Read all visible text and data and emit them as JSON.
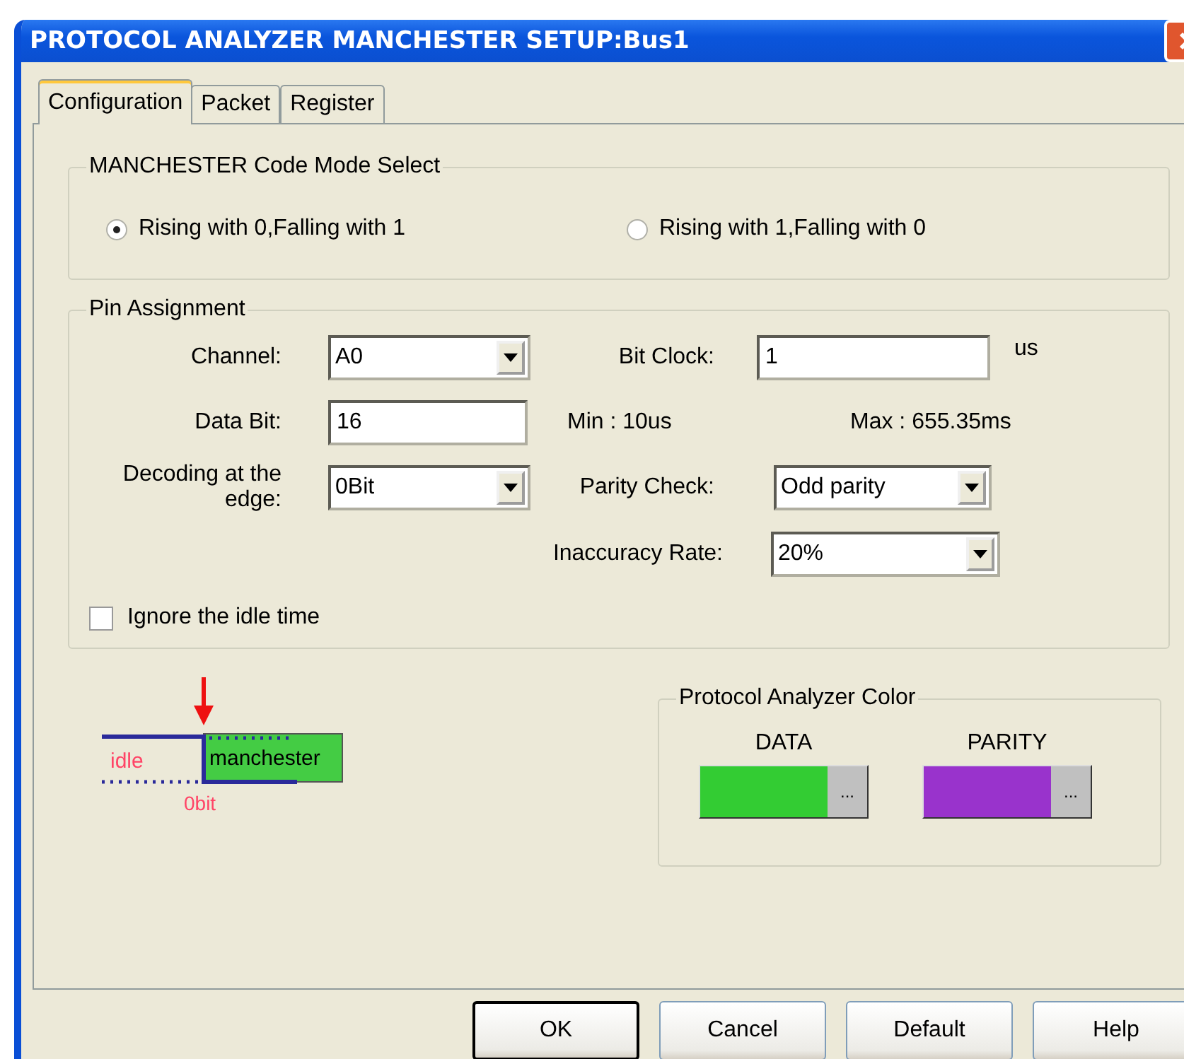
{
  "window": {
    "title": "PROTOCOL ANALYZER MANCHESTER SETUP:Bus1"
  },
  "tabs": [
    {
      "label": "Configuration",
      "selected": true
    },
    {
      "label": "Packet",
      "selected": false
    },
    {
      "label": "Register",
      "selected": false
    }
  ],
  "mode_group": {
    "title": "MANCHESTER Code Mode Select",
    "options": [
      {
        "label": "Rising with 0,Falling with 1",
        "selected": true
      },
      {
        "label": "Rising with 1,Falling with 0",
        "selected": false
      }
    ]
  },
  "pin_assignment": {
    "title": "Pin Assignment",
    "channel": {
      "label": "Channel:",
      "value": "A0"
    },
    "bit_clock": {
      "label": "Bit Clock:",
      "value": "1",
      "unit": "us"
    },
    "data_bit": {
      "label": "Data Bit:",
      "value": "16"
    },
    "min": "Min : 10us",
    "max": "Max : 655.35ms",
    "decoding": {
      "label": "Decoding at the edge:",
      "value": "0Bit"
    },
    "parity": {
      "label": "Parity Check:",
      "value": "Odd parity"
    },
    "inaccuracy": {
      "label": "Inaccuracy Rate:",
      "value": "20%"
    },
    "ignore_idle": {
      "label": "Ignore the idle time",
      "checked": false
    }
  },
  "diagram": {
    "idle": "idle",
    "signal": "manchester",
    "offset": "0bit"
  },
  "color_group": {
    "title": "Protocol Analyzer Color",
    "swatches": [
      {
        "label": "DATA",
        "color": "#33cc33",
        "button": "..."
      },
      {
        "label": "PARITY",
        "color": "#9933cc",
        "button": "..."
      }
    ]
  },
  "buttons": [
    {
      "label": "OK",
      "default": true
    },
    {
      "label": "Cancel",
      "default": false
    },
    {
      "label": "Default",
      "default": false
    },
    {
      "label": "Help",
      "default": false
    }
  ]
}
